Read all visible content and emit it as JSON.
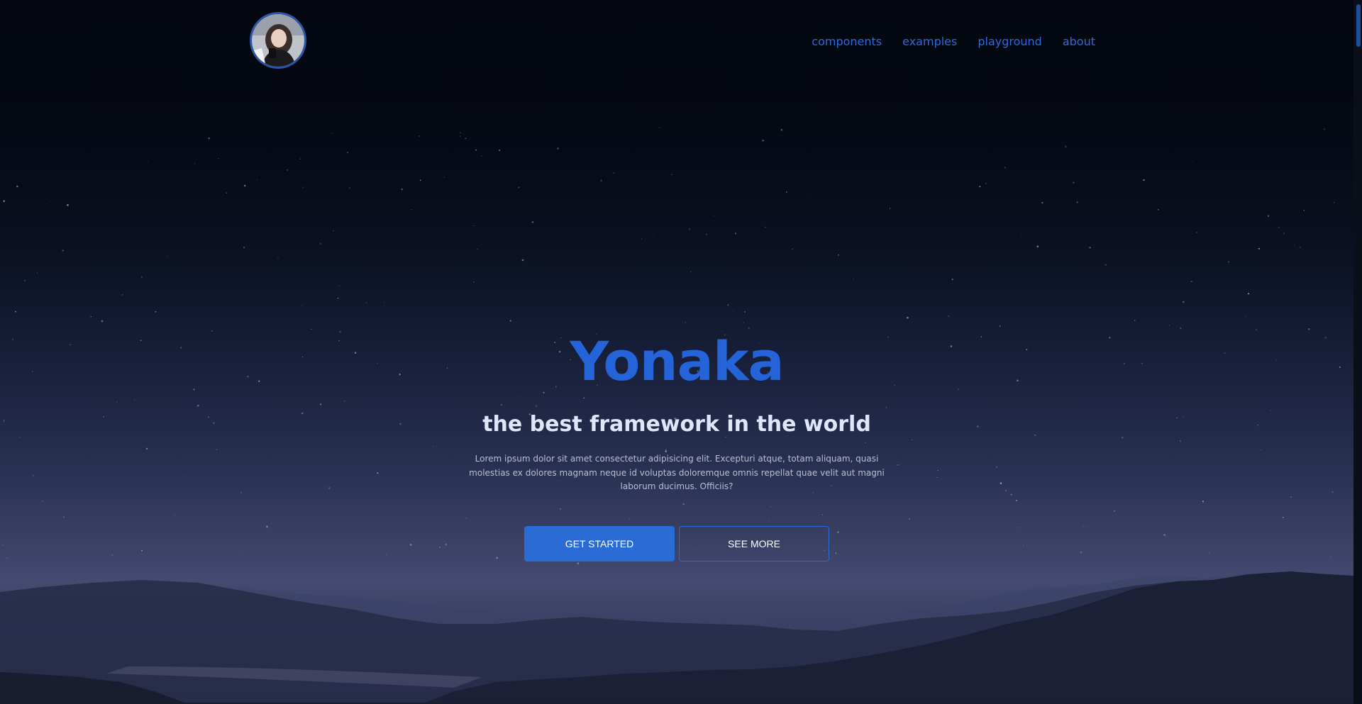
{
  "header": {
    "avatar_icon": "profile-photo",
    "nav": [
      {
        "label": "components"
      },
      {
        "label": "examples"
      },
      {
        "label": "playground"
      },
      {
        "label": "about"
      }
    ]
  },
  "hero": {
    "title": "Yonaka",
    "subtitle": "the best framework in the world",
    "description": "Lorem ipsum dolor sit amet consectetur adipisicing elit. Excepturi atque, totam aliquam, quasi molestias ex dolores magnam neque id voluptas doloremque omnis repellat quae velit aut magni laborum ducimus. Officiis?",
    "primary_button": "GET STARTED",
    "secondary_button": "SEE MORE"
  },
  "colors": {
    "accent": "#2563d8",
    "nav_link": "#2f6ad6",
    "button": "#2a6bd6",
    "subtitle": "#dfe6f8",
    "background": "#050812"
  }
}
